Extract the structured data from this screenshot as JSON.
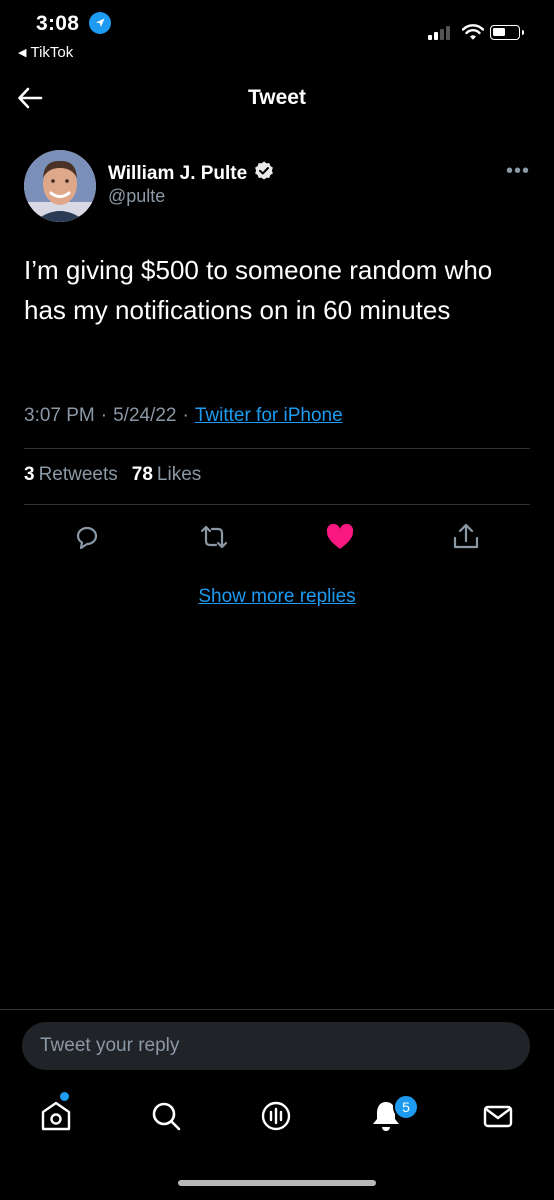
{
  "status_bar": {
    "time": "3:08",
    "back_app": "TikTok",
    "icons": [
      "location-arrow-icon",
      "signal-icon",
      "wifi-icon",
      "battery-icon"
    ]
  },
  "header": {
    "title": "Tweet",
    "back_icon": "back-arrow-icon"
  },
  "tweet": {
    "author_name": "William J. Pulte",
    "verified_icon": "verified-badge-icon",
    "handle": "@pulte",
    "text": "I’m giving $500 to someone random who has my notifications on in 60 minutes",
    "time": "3:07 PM",
    "date": "5/24/22",
    "separator": "·",
    "source": "Twitter for iPhone",
    "retweets_count": "3",
    "retweets_label": "Retweets",
    "likes_count": "78",
    "likes_label": "Likes",
    "actions": [
      "reply-icon",
      "retweet-icon",
      "like-icon",
      "share-icon"
    ],
    "liked": true
  },
  "show_more_replies": "Show more replies",
  "reply": {
    "placeholder": "Tweet your reply"
  },
  "tab_bar": {
    "items": [
      "home-icon",
      "search-icon",
      "spaces-icon",
      "notifications-icon",
      "messages-icon"
    ],
    "notifications_badge": "5"
  },
  "colors": {
    "accent": "#1d9bf0",
    "like": "#f91880",
    "background": "#000000",
    "secondary_text": "#8b98a5"
  }
}
